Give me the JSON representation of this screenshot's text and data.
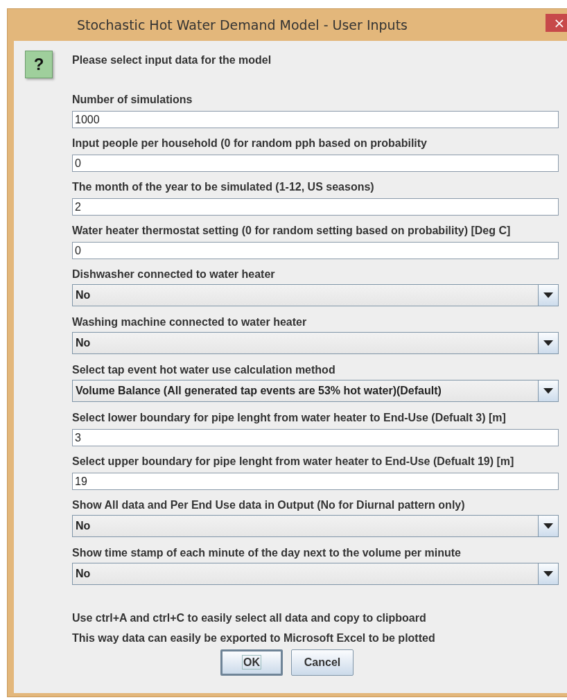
{
  "window": {
    "title": "Stochastic Hot Water Demand Model - User Inputs",
    "close": "×"
  },
  "icon": "?",
  "message": "Please select input data for the model",
  "fields": [
    {
      "kind": "text",
      "label": "Number of simulations",
      "value": "1000"
    },
    {
      "kind": "text",
      "label": "Input people per household (0 for random pph based on probability",
      "value": "0"
    },
    {
      "kind": "text",
      "label": "The month of the year to be simulated (1-12, US seasons)",
      "value": "2"
    },
    {
      "kind": "text",
      "label": "Water heater thermostat setting (0 for random setting based on probability) [Deg C]",
      "value": "0"
    },
    {
      "kind": "select",
      "label": "Dishwasher connected to water heater",
      "value": "No"
    },
    {
      "kind": "select",
      "label": "Washing machine connected to water heater",
      "value": "No"
    },
    {
      "kind": "select",
      "label": "Select tap event hot water use calculation method",
      "value": "Volume Balance (All generated tap events are 53% hot water)(Default)"
    },
    {
      "kind": "text",
      "label": "Select lower boundary for pipe lenght from water heater to End-Use (Defualt 3) [m]",
      "value": "3"
    },
    {
      "kind": "text",
      "label": "Select upper boundary for pipe lenght from water heater to End-Use (Defualt 19) [m]",
      "value": "19"
    },
    {
      "kind": "select",
      "label": "Show All data and Per End Use data in Output (No for Diurnal pattern only)",
      "value": "No"
    },
    {
      "kind": "select",
      "label": "Show time stamp of each minute of the day next to the volume per minute",
      "value": "No"
    }
  ],
  "notes": [
    "Use ctrl+A and ctrl+C to easily select all data and copy to clipboard",
    "This way data can easily be exported to Microsoft Excel to be plotted"
  ],
  "buttons": [
    {
      "label": "OK",
      "focused": true
    },
    {
      "label": "Cancel",
      "focused": false
    }
  ]
}
